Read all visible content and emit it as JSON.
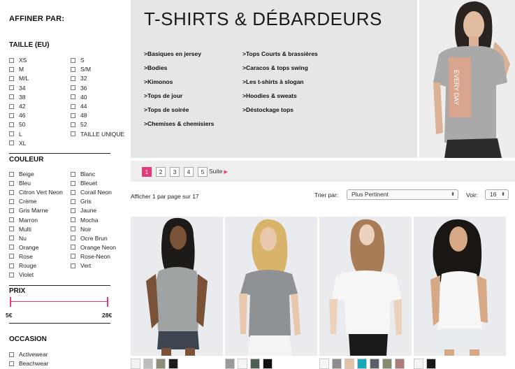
{
  "sidebar": {
    "title": "AFFINER PAR:",
    "size": {
      "heading": "TAILLE (EU)",
      "col1": [
        "XS",
        "M",
        "M/L",
        "34",
        "38",
        "42",
        "46",
        "50",
        "L",
        "XL"
      ],
      "col2": [
        "S",
        "S/M",
        "32",
        "36",
        "40",
        "44",
        "48",
        "52",
        "TAILLE UNIQUE"
      ]
    },
    "color": {
      "heading": "COULEUR",
      "col1": [
        "Beige",
        "Bleu",
        "Citron Vert Neon",
        "Crème",
        "Gris Marne",
        "Marron",
        "Multi",
        "Nu",
        "Orange",
        "Rose",
        "Rouge",
        "Violet"
      ],
      "col2": [
        "Blanc",
        "Bleuet",
        "Corail Neon",
        "Gris",
        "Jaune",
        "Mocha",
        "Noir",
        "Ocre Brun",
        "Orange Neon",
        "Rose-Neon",
        "Vert"
      ]
    },
    "price": {
      "heading": "PRIX",
      "min_label": "5€",
      "max_label": "28€"
    },
    "occasion": {
      "heading": "OCCASION",
      "items": [
        "Activewear",
        "Beachwear"
      ]
    }
  },
  "banner": {
    "title": "T-SHIRTS & DÉBARDEURS",
    "links_left": [
      ">Basiques en jersey",
      ">Bodies",
      ">Kimonos",
      ">Tops de jour",
      ">Tops de soirée",
      ">Chemises & chemisiers"
    ],
    "links_right": [
      ">Tops Courts & brassières",
      ">Caracos & tops swing",
      ">Les t-shirts à slogan",
      ">Hoodies & sweats",
      ">Déstockage tops"
    ],
    "shirt_print": "EVERY DAY"
  },
  "pagination": {
    "pages": [
      "1",
      "2",
      "3",
      "4",
      "5"
    ],
    "active": "1",
    "next_label": "Suite"
  },
  "toolbar": {
    "showing": "Afficher 1 par page sur 17",
    "sort_label": "Trier par:",
    "sort_value": "Plus Pertinent",
    "view_label": "Voir:",
    "view_value": "16"
  },
  "products": [
    {
      "swatches": [
        "#f2f2f2",
        "#bdbdbd",
        "#8f8c7a",
        "#1b1b1b"
      ]
    },
    {
      "swatches": [
        "#9a9a9a",
        "#f4f4f4",
        "#4f5e55",
        "#111111"
      ]
    },
    {
      "swatches": [
        "#f6f6f6",
        "#8d8d8d",
        "#e3c3a4",
        "#18a9b8",
        "#5a6068",
        "#8a8a70",
        "#ad7b7b"
      ]
    },
    {
      "swatches": [
        "#f4f4f4",
        "#1a1a1a"
      ]
    }
  ],
  "colors": {
    "accent": "#e6397a",
    "banner_bg": "#e6e6e6"
  }
}
